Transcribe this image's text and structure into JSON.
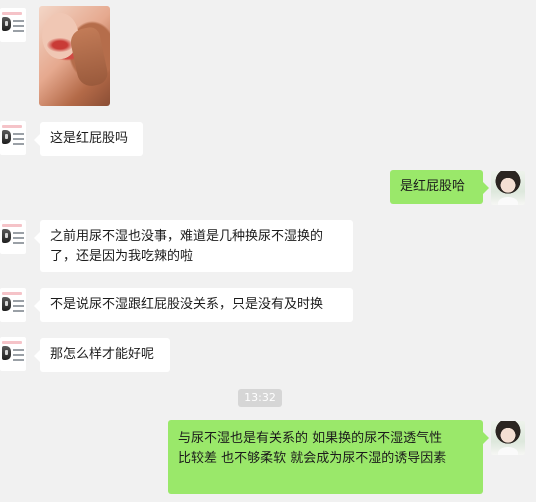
{
  "chat": {
    "messages": [
      {
        "sender": "contact",
        "type": "image",
        "description": ""
      },
      {
        "sender": "contact",
        "text": "这是红屁股吗"
      },
      {
        "sender": "self",
        "text": "是红屁股哈"
      },
      {
        "sender": "contact",
        "lines": [
          "之前用尿不湿也没事，难道是几种换尿不湿换的",
          "了，还是因为我吃辣的啦"
        ]
      },
      {
        "sender": "contact",
        "text": "不是说尿不湿跟红屁股没关系，只是没有及时换"
      },
      {
        "sender": "contact",
        "text": "那怎么样才能好呢"
      },
      {
        "sender": "self",
        "lines": [
          "与尿不湿也是有关系的  如果换的尿不湿透气性",
          "比较差  也不够柔软 就会成为尿不湿的诱导因素"
        ]
      }
    ],
    "timestamp": "13:32"
  },
  "colors": {
    "background": "#f1f1f1",
    "self_bubble": "#9ae86a",
    "contact_bubble": "#ffffff"
  }
}
